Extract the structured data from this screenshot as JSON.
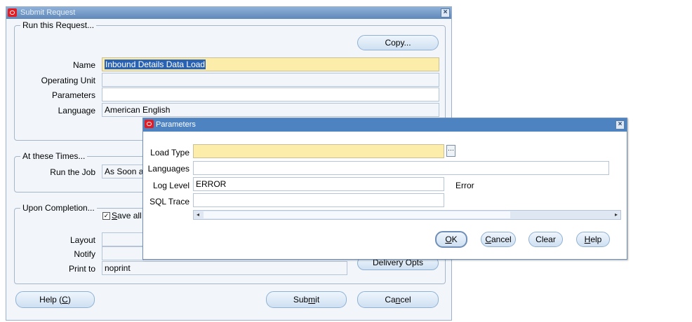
{
  "submit_window": {
    "title": "Submit Request",
    "run_group": {
      "title": "Run this Request...",
      "copy_button": "Copy...",
      "name_label": "Name",
      "name_value": "Inbound Details Data Load",
      "operating_unit_label": "Operating Unit",
      "operating_unit_value": "",
      "parameters_label": "Parameters",
      "parameters_value": "",
      "language_label": "Language",
      "language_value": "American English"
    },
    "times_group": {
      "title": "At these Times...",
      "run_job_label": "Run the Job",
      "run_job_value": "As Soon a"
    },
    "completion_group": {
      "title": "Upon Completion...",
      "save_all_label_prefix": "S",
      "save_all_label_rest": "ave all",
      "save_all_checked": true,
      "layout_label": "Layout",
      "notify_label": "Notify",
      "print_to_label": "Print to",
      "print_to_value": "noprint",
      "delivery_button_pre": "Delivery",
      "delivery_button_u": "y",
      "delivery_button_post": " Opts"
    },
    "buttons": {
      "help_pre": "Help (",
      "help_u": "C",
      "help_post": ")",
      "submit_pre": "Sub",
      "submit_u": "m",
      "submit_post": "it",
      "cancel_pre": "Ca",
      "cancel_u": "n",
      "cancel_post": "cel"
    }
  },
  "parameters_dialog": {
    "title": "Parameters",
    "load_type_label": "Load Type",
    "load_type_value": "",
    "languages_label": "Languages",
    "languages_value": "",
    "log_level_label": "Log Level",
    "log_level_value": "ERROR",
    "log_level_desc": "Error",
    "sql_trace_label": "SQL Trace",
    "sql_trace_value": "",
    "ok_u": "O",
    "ok_post": "K",
    "cancel_u": "C",
    "cancel_post": "ancel",
    "clear_label": "Clear",
    "help_u": "H",
    "help_post": "elp"
  },
  "icons": {
    "oracle_logo": "oracle-logo-icon",
    "close": "close-icon",
    "lov": "ellipsis-icon"
  }
}
